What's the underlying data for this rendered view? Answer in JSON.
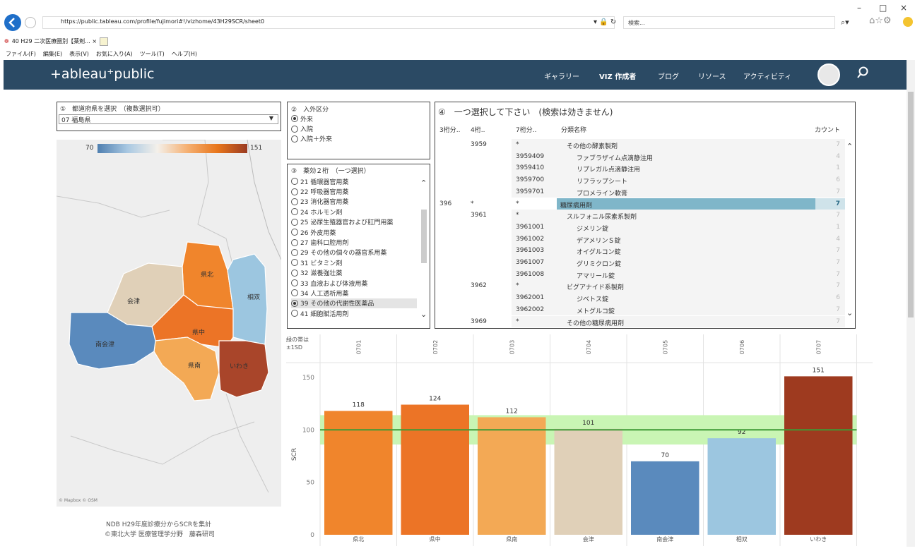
{
  "browser": {
    "url": "https://public.tableau.com/profile/fujimori#!/vizhome/43H29SCR/sheet0",
    "search_placeholder": "検索...",
    "tab_title": "40 H29 二次医療圏別【薬剤... ×",
    "menu": [
      "ファイル(F)",
      "編集(E)",
      "表示(V)",
      "お気に入り(A)",
      "ツール(T)",
      "ヘルプ(H)"
    ],
    "window_controls": [
      "–",
      "□",
      "×"
    ]
  },
  "header": {
    "logo": "+ableau⁺public",
    "nav": [
      "ギャラリー",
      "VIZ 作成者",
      "ブログ",
      "リソース",
      "アクティビティ"
    ]
  },
  "filter1": {
    "title": "①　都道府県を選択　（複数選択可）",
    "value": "07 福島県"
  },
  "legend": {
    "min": "70",
    "max": "151",
    "colors": [
      "#4f7fb0",
      "#a9c8e2",
      "#f4f0ea",
      "#f5b072",
      "#e8761c",
      "#9a3b22"
    ]
  },
  "map": {
    "credit": "© Mapbox  © OSM",
    "regions": [
      {
        "name": "県北",
        "color": "#f0852c"
      },
      {
        "name": "県中",
        "color": "#ec7426"
      },
      {
        "name": "県南",
        "color": "#f3a955"
      },
      {
        "name": "会津",
        "color": "#e0d0b8"
      },
      {
        "name": "南会津",
        "color": "#5a8abd"
      },
      {
        "name": "相双",
        "color": "#9cc6e0"
      },
      {
        "name": "いわき",
        "color": "#a9452a"
      }
    ]
  },
  "footer": {
    "line1": "NDB H29年度診療分からSCRを集計",
    "line2": "©東北大学 医療管理学分野　藤森研司"
  },
  "filter2": {
    "title": "②　入外区分",
    "options": [
      {
        "label": "外来",
        "selected": true
      },
      {
        "label": "入院",
        "selected": false
      },
      {
        "label": "入院＋外来",
        "selected": false
      }
    ]
  },
  "filter3": {
    "title": "③　薬効２桁　（一つ選択）",
    "options": [
      {
        "label": "21 循環器官用薬",
        "selected": false
      },
      {
        "label": "22 呼吸器官用薬",
        "selected": false
      },
      {
        "label": "23 消化器官用薬",
        "selected": false
      },
      {
        "label": "24 ホルモン剤",
        "selected": false
      },
      {
        "label": "25 泌尿生殖器官および肛門用薬",
        "selected": false
      },
      {
        "label": "26 外皮用薬",
        "selected": false
      },
      {
        "label": "27 歯科口腔用剤",
        "selected": false
      },
      {
        "label": "29 その他の個々の器官系用薬",
        "selected": false
      },
      {
        "label": "31 ビタミン剤",
        "selected": false
      },
      {
        "label": "32 滋養強壮薬",
        "selected": false
      },
      {
        "label": "33 血液および体液用薬",
        "selected": false
      },
      {
        "label": "34 人工透析用薬",
        "selected": false
      },
      {
        "label": "39 その他の代謝性医薬品",
        "selected": true
      },
      {
        "label": "41 細胞賦活用剤",
        "selected": false
      }
    ]
  },
  "table": {
    "title": "④　一つ選択して下さい　(検索は効きません)",
    "headers": [
      "3桁分..",
      "4桁..",
      "7桁分..",
      "分類名称",
      "カウント"
    ],
    "rows": [
      {
        "c3": "",
        "c4": "3959",
        "c7": "*",
        "name": "その他の酵素製剤",
        "indent": 0,
        "count": "7"
      },
      {
        "c3": "",
        "c4": "",
        "c7": "3959409",
        "name": "ファブラザイム点滴静注用",
        "indent": 1,
        "count": "4"
      },
      {
        "c3": "",
        "c4": "",
        "c7": "3959410",
        "name": "リプレガル点滴静注用",
        "indent": 1,
        "count": "1"
      },
      {
        "c3": "",
        "c4": "",
        "c7": "3959700",
        "name": "リフラップシート",
        "indent": 1,
        "count": "6"
      },
      {
        "c3": "",
        "c4": "",
        "c7": "3959701",
        "name": "ブロメライン軟膏",
        "indent": 1,
        "count": "7"
      },
      {
        "c3": "396",
        "c4": "*",
        "c7": "*",
        "name": "糖尿病用剤",
        "indent": -1,
        "count": "7",
        "selected": true
      },
      {
        "c3": "",
        "c4": "3961",
        "c7": "*",
        "name": "スルフォニル尿素系製剤",
        "indent": 0,
        "count": "7"
      },
      {
        "c3": "",
        "c4": "",
        "c7": "3961001",
        "name": "ジメリン錠",
        "indent": 1,
        "count": "1"
      },
      {
        "c3": "",
        "c4": "",
        "c7": "3961002",
        "name": "デアメリンＳ錠",
        "indent": 1,
        "count": "4"
      },
      {
        "c3": "",
        "c4": "",
        "c7": "3961003",
        "name": "オイグルコン錠",
        "indent": 1,
        "count": "7"
      },
      {
        "c3": "",
        "c4": "",
        "c7": "3961007",
        "name": "グリミクロン錠",
        "indent": 1,
        "count": "7"
      },
      {
        "c3": "",
        "c4": "",
        "c7": "3961008",
        "name": "アマリール錠",
        "indent": 1,
        "count": "7"
      },
      {
        "c3": "",
        "c4": "3962",
        "c7": "*",
        "name": "ビグアナイド系製剤",
        "indent": 0,
        "count": "7"
      },
      {
        "c3": "",
        "c4": "",
        "c7": "3962001",
        "name": "ジベトス錠",
        "indent": 1,
        "count": "6"
      },
      {
        "c3": "",
        "c4": "",
        "c7": "3962002",
        "name": "メトグルコ錠",
        "indent": 1,
        "count": "7"
      },
      {
        "c3": "",
        "c4": "3969",
        "c7": "*",
        "name": "その他の糖尿病用剤",
        "indent": 0,
        "count": "7"
      }
    ]
  },
  "chart_data": {
    "type": "bar",
    "band_note": "緑の帯は\n±1SD",
    "ylabel": "SCR",
    "ylim": [
      0,
      160
    ],
    "yticks": [
      0,
      50,
      100,
      150
    ],
    "reference_line": 100,
    "band": [
      86,
      114
    ],
    "codes": [
      "0701",
      "0702",
      "0703",
      "0704",
      "0705",
      "0706",
      "0707"
    ],
    "categories": [
      "県北",
      "県中",
      "県南",
      "会津",
      "南会津",
      "相双",
      "いわき"
    ],
    "values": [
      118,
      124,
      112,
      101,
      70,
      92,
      151
    ],
    "colors": [
      "#f0852c",
      "#ec7426",
      "#f3a955",
      "#e0d0b8",
      "#5a8abd",
      "#9cc6e0",
      "#9e3a1f"
    ]
  }
}
